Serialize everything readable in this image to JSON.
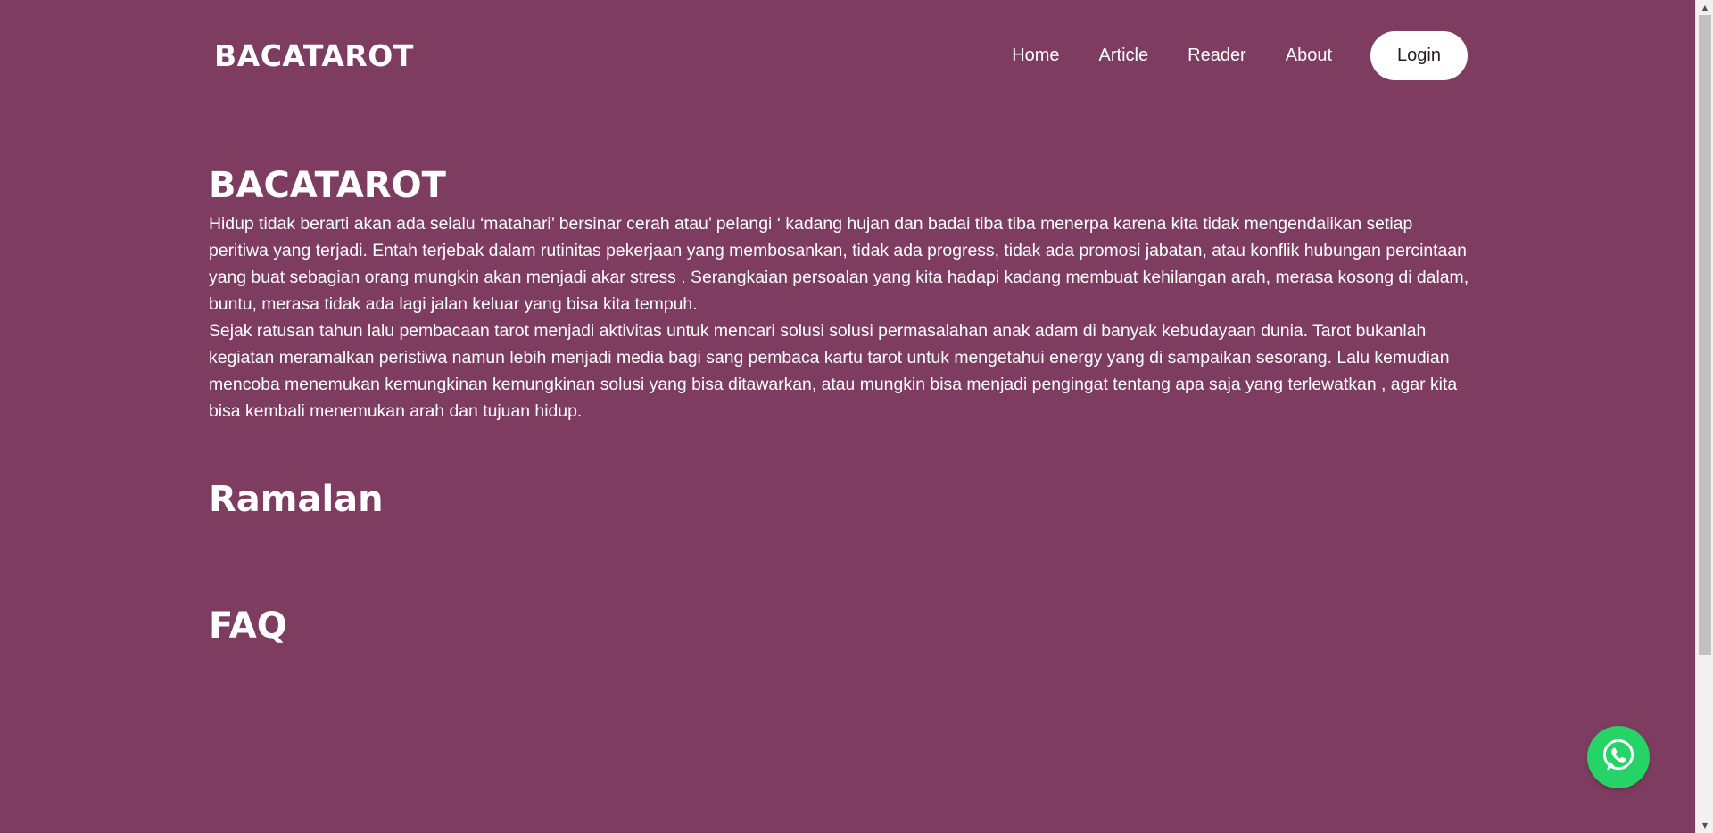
{
  "header": {
    "brand": "BACATAROT",
    "nav": [
      {
        "label": "Home"
      },
      {
        "label": "Article"
      },
      {
        "label": "Reader"
      },
      {
        "label": "About"
      }
    ],
    "login_label": "Login"
  },
  "hero": {
    "title": "BACATAROT",
    "paragraph_1": "Hidup tidak berarti akan ada selalu ‘matahari’ bersinar cerah atau’ pelangi ‘ kadang hujan dan badai tiba tiba menerpa karena kita tidak mengendalikan setiap peritiwa yang terjadi. Entah terjebak dalam rutinitas pekerjaan yang membosankan, tidak ada progress, tidak ada promosi jabatan, atau konflik hubungan percintaan yang buat sebagian orang mungkin akan menjadi akar stress . Serangkaian persoalan yang kita hadapi kadang membuat kehilangan arah, merasa kosong di dalam, buntu, merasa tidak ada lagi jalan keluar yang bisa kita tempuh.",
    "paragraph_2": "Sejak ratusan tahun lalu pembacaan tarot menjadi aktivitas untuk mencari solusi solusi permasalahan anak adam di banyak kebudayaan dunia. Tarot bukanlah kegiatan meramalkan peristiwa namun lebih menjadi media bagi sang pembaca kartu tarot untuk mengetahui energy yang di sampaikan sesorang. Lalu kemudian mencoba menemukan kemungkinan kemungkinan solusi yang bisa ditawarkan, atau mungkin bisa menjadi pengingat tentang apa saja yang terlewatkan , agar kita bisa kembali menemukan arah dan tujuan hidup."
  },
  "sections": {
    "ramalan_title": "Ramalan",
    "faq_title": "FAQ"
  },
  "floating": {
    "whatsapp_icon": "whatsapp-icon",
    "whatsapp_color": "#25d366"
  },
  "theme": {
    "background": "#7e3d60",
    "text": "#ffffff",
    "button_bg": "#ffffff"
  }
}
